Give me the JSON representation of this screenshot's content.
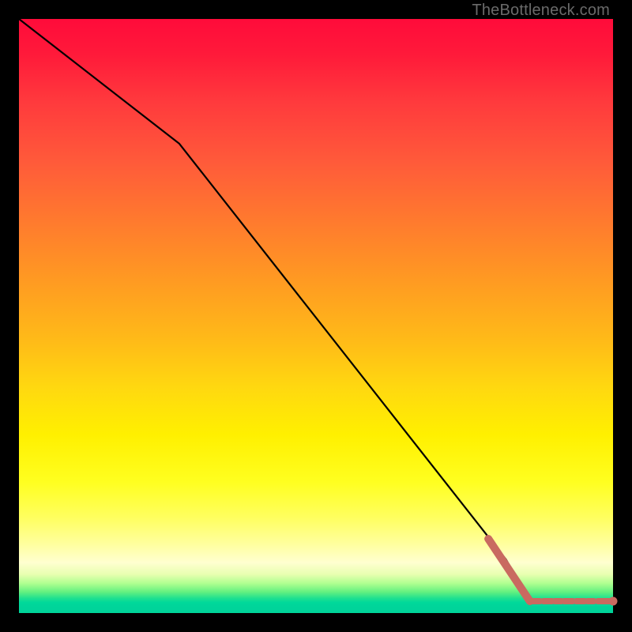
{
  "attribution": "TheBottleneck.com",
  "colors": {
    "black": "#000000",
    "marker": "#c96a60",
    "line": "#000000"
  },
  "chart_data": {
    "type": "line",
    "title": "",
    "xlabel": "",
    "ylabel": "",
    "xlim": [
      0,
      100
    ],
    "ylim": [
      0,
      100
    ],
    "grid": false,
    "legend": false,
    "series": [
      {
        "name": "curve",
        "style": "solid-black",
        "x": [
          0,
          27,
          82,
          86,
          100
        ],
        "y": [
          100,
          79,
          9,
          2,
          2
        ]
      },
      {
        "name": "highlight-thick",
        "style": "thick-salmon",
        "x": [
          79,
          86
        ],
        "y": [
          12.5,
          2
        ]
      },
      {
        "name": "highlight-dashes",
        "style": "dashed-salmon-dots",
        "x": [
          86,
          88,
          90,
          91.5,
          93.5,
          95.5,
          97,
          100
        ],
        "y": [
          2,
          2,
          2,
          2,
          2,
          2,
          2,
          2
        ]
      }
    ]
  }
}
